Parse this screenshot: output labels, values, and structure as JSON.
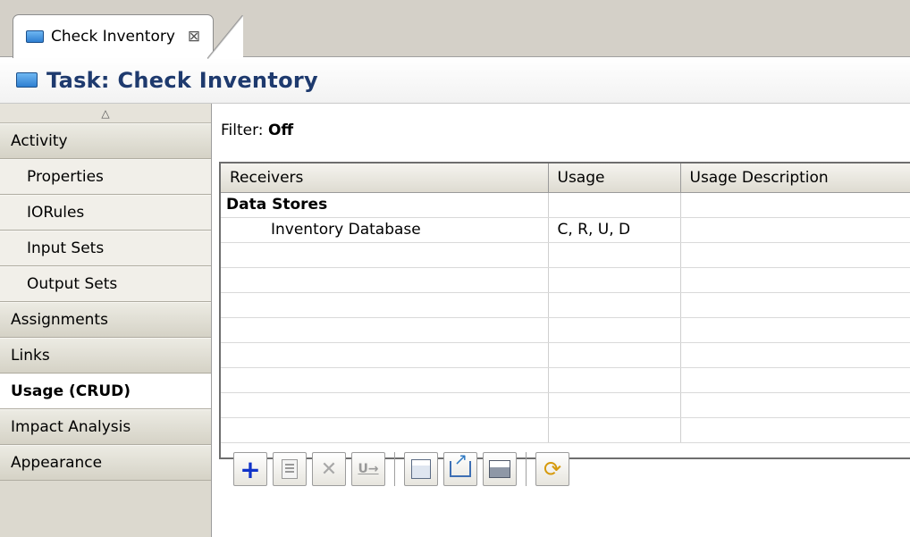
{
  "editor_tab": {
    "title": "Check Inventory",
    "close": "⊠"
  },
  "header": {
    "title": "Task: Check Inventory"
  },
  "sidebar": {
    "items": [
      {
        "label": "Activity",
        "type": "group"
      },
      {
        "label": "Properties",
        "type": "sub"
      },
      {
        "label": "IORules",
        "type": "sub"
      },
      {
        "label": "Input Sets",
        "type": "sub"
      },
      {
        "label": "Output Sets",
        "type": "sub"
      },
      {
        "label": "Assignments",
        "type": "group"
      },
      {
        "label": "Links",
        "type": "group"
      },
      {
        "label": "Usage (CRUD)",
        "type": "active"
      },
      {
        "label": "Impact Analysis",
        "type": "group"
      },
      {
        "label": "Appearance",
        "type": "group"
      }
    ]
  },
  "filter": {
    "label": "Filter:",
    "value": "Off"
  },
  "table": {
    "columns": [
      "Receivers",
      "Usage",
      "Usage Description"
    ],
    "rows": [
      {
        "receivers": "Data Stores",
        "usage": "",
        "description": "",
        "kind": "group"
      },
      {
        "receivers": "Inventory Database",
        "usage": "C, R, U, D",
        "description": "",
        "kind": "item"
      }
    ]
  },
  "toolbar": {
    "buttons": [
      {
        "name": "add",
        "icon": "plus-icon",
        "enabled": true
      },
      {
        "name": "edit",
        "icon": "edit-icon",
        "enabled": false
      },
      {
        "name": "delete",
        "icon": "delete-icon",
        "enabled": false
      },
      {
        "name": "update",
        "icon": "update-icon",
        "enabled": false
      },
      {
        "name": "table",
        "icon": "table-icon",
        "enabled": true
      },
      {
        "name": "export",
        "icon": "export-icon",
        "enabled": true
      },
      {
        "name": "print",
        "icon": "print-icon",
        "enabled": true
      },
      {
        "name": "refresh",
        "icon": "refresh-icon",
        "enabled": true
      }
    ]
  }
}
